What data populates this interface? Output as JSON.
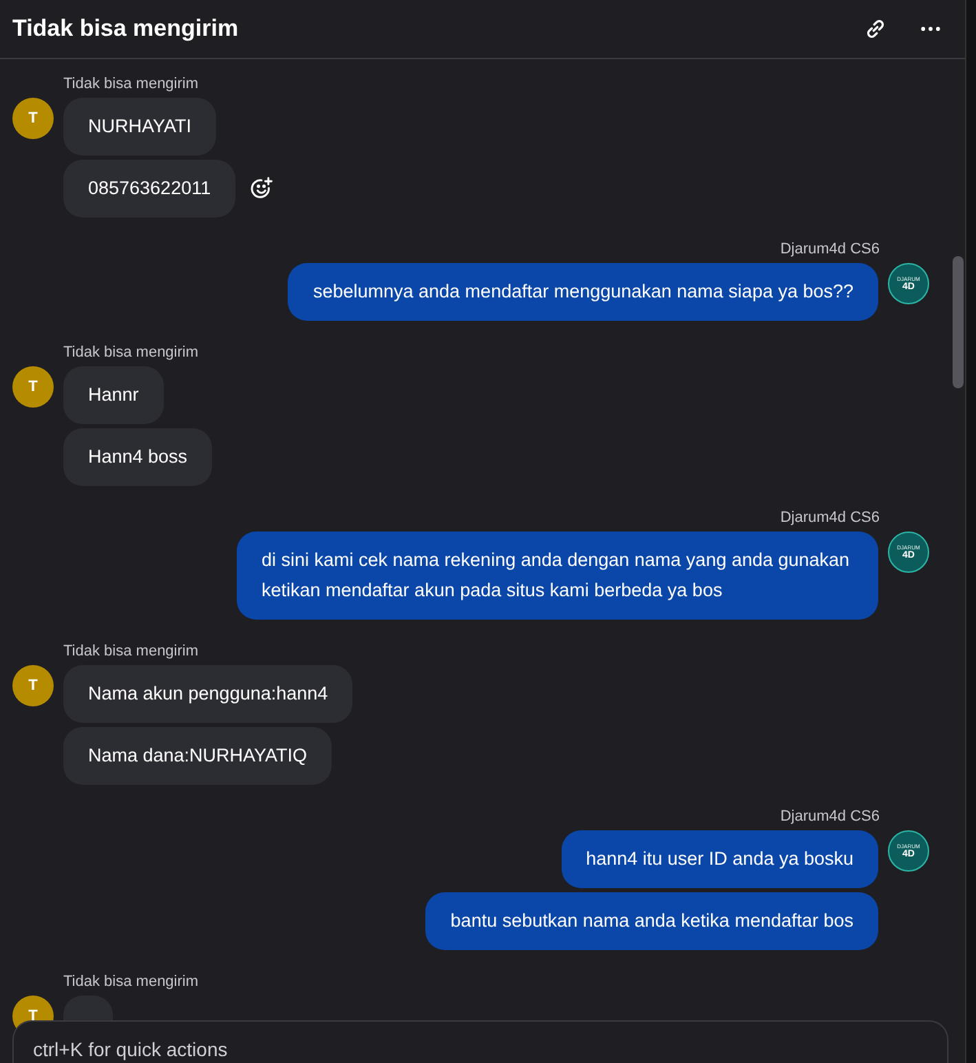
{
  "header": {
    "title": "Tidak bisa mengirim"
  },
  "messages": [
    {
      "kind": "incoming",
      "sender": "Tidak bisa mengirim",
      "avatar": {
        "initial": "T"
      },
      "bubbles": [
        {
          "text": "NURHAYATI",
          "react_button": false
        },
        {
          "text": "085763622011",
          "react_button": true
        }
      ]
    },
    {
      "kind": "outgoing",
      "sender": "Djarum4d CS6",
      "avatar": {
        "line1": "DJARUM",
        "line2": "4D"
      },
      "bubbles": [
        {
          "text": "sebelumnya anda mendaftar menggunakan nama siapa ya bos??",
          "react_button": false
        }
      ]
    },
    {
      "kind": "incoming",
      "sender": "Tidak bisa mengirim",
      "avatar": {
        "initial": "T"
      },
      "bubbles": [
        {
          "text": "Hannr",
          "react_button": false
        },
        {
          "text": "Hann4 boss",
          "react_button": false
        }
      ]
    },
    {
      "kind": "outgoing",
      "sender": "Djarum4d CS6",
      "avatar": {
        "line1": "DJARUM",
        "line2": "4D"
      },
      "bubbles": [
        {
          "text": "di sini kami cek nama rekening anda dengan nama yang anda gunakan ketikan mendaftar akun pada situs kami berbeda ya bos",
          "react_button": false
        }
      ]
    },
    {
      "kind": "incoming",
      "sender": "Tidak bisa mengirim",
      "avatar": {
        "initial": "T"
      },
      "bubbles": [
        {
          "text": "Nama akun pengguna:hann4",
          "react_button": false
        },
        {
          "text": "Nama dana:NURHAYATIQ",
          "react_button": false
        }
      ]
    },
    {
      "kind": "outgoing",
      "sender": "Djarum4d CS6",
      "avatar": {
        "line1": "DJARUM",
        "line2": "4D"
      },
      "bubbles": [
        {
          "text": "hann4 itu user ID anda ya bosku",
          "react_button": false
        },
        {
          "text": "bantu sebutkan nama anda ketika mendaftar bos",
          "react_button": false
        }
      ]
    },
    {
      "kind": "incoming",
      "sender": "Tidak bisa mengirim",
      "avatar": {
        "initial": "T"
      },
      "bubbles": [
        {
          "react_button": false
        }
      ]
    }
  ],
  "composer": {
    "placeholder": "ctrl+K for quick actions"
  }
}
